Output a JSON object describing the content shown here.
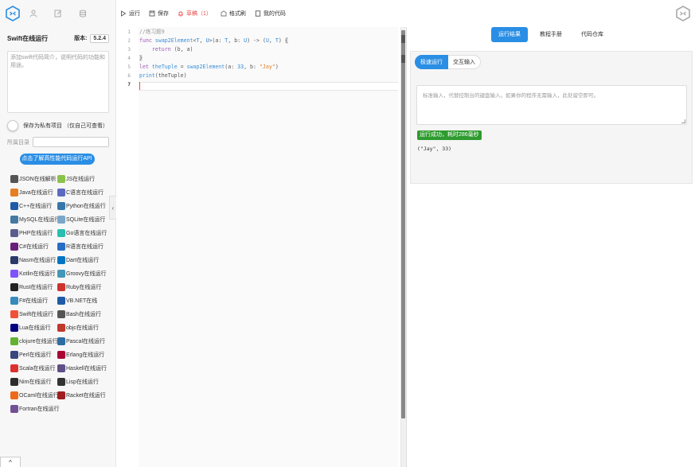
{
  "toolbar": {
    "run": "运行",
    "save": "保存",
    "draft": "草稿（1）",
    "format": "格式刷",
    "mycode": "我的代码"
  },
  "sidebar": {
    "title": "Swift在线运行",
    "version_label": "版本:",
    "version_value": "5.2.4",
    "desc_placeholder": "添加swift代码简介，说明代码的功能和用途。",
    "private_label": "保存为私有项目 （仅自己可查看）",
    "dir_label": "所属目录",
    "api_button": "点击了解高性能代码运行API",
    "languages": [
      {
        "label": "JSON在线解析",
        "color": "#555555",
        "icon": "json-icon"
      },
      {
        "label": "JS在线运行",
        "color": "#8bc34a",
        "icon": "nodejs-icon"
      },
      {
        "label": "Java在线运行",
        "color": "#e67e22",
        "icon": "java-icon"
      },
      {
        "label": "C语言在线运行",
        "color": "#5c6bc0",
        "icon": "c-icon"
      },
      {
        "label": "C++在线运行",
        "color": "#1e5aa8",
        "icon": "cpp-icon"
      },
      {
        "label": "Python在线运行",
        "color": "#3776ab",
        "icon": "python-icon"
      },
      {
        "label": "MySQL在线运行",
        "color": "#4479a1",
        "icon": "mysql-icon"
      },
      {
        "label": "SQLite在线运行",
        "color": "#7aa7c7",
        "icon": "sqlite-icon"
      },
      {
        "label": "PHP在线运行",
        "color": "#5b5e8c",
        "icon": "php-icon"
      },
      {
        "label": "Go语言在线运行",
        "color": "#29beb0",
        "icon": "go-icon"
      },
      {
        "label": "C#在线运行",
        "color": "#68217a",
        "icon": "csharp-icon"
      },
      {
        "label": "R语言在线运行",
        "color": "#276dc3",
        "icon": "r-icon"
      },
      {
        "label": "Nasm在线运行",
        "color": "#2b3a67",
        "icon": "nasm-icon"
      },
      {
        "label": "Dart在线运行",
        "color": "#0175c2",
        "icon": "dart-icon"
      },
      {
        "label": "Kotlin在线运行",
        "color": "#7f52ff",
        "icon": "kotlin-icon"
      },
      {
        "label": "Groovy在线运行",
        "color": "#4298b8",
        "icon": "groovy-icon"
      },
      {
        "label": "Rust在线运行",
        "color": "#222222",
        "icon": "rust-icon"
      },
      {
        "label": "Ruby在线运行",
        "color": "#cc342d",
        "icon": "ruby-icon"
      },
      {
        "label": "F#在线运行",
        "color": "#378bba",
        "icon": "fsharp-icon"
      },
      {
        "label": "VB.NET在线",
        "color": "#1e5aa8",
        "icon": "vbnet-icon"
      },
      {
        "label": "Swift在线运行",
        "color": "#f05138",
        "icon": "swift-icon"
      },
      {
        "label": "Bash在线运行",
        "color": "#555555",
        "icon": "bash-icon"
      },
      {
        "label": "Lua在线运行",
        "color": "#000080",
        "icon": "lua-icon"
      },
      {
        "label": "objc在线运行",
        "color": "#c0392b",
        "icon": "objc-icon"
      },
      {
        "label": "clojure在线运行",
        "color": "#63b132",
        "icon": "clojure-icon"
      },
      {
        "label": "Pascal在线运行",
        "color": "#2e6da4",
        "icon": "pascal-icon"
      },
      {
        "label": "Perl在线运行",
        "color": "#39457e",
        "icon": "perl-icon"
      },
      {
        "label": "Erlang在线运行",
        "color": "#a90533",
        "icon": "erlang-icon"
      },
      {
        "label": "Scala在线运行",
        "color": "#dc322f",
        "icon": "scala-icon"
      },
      {
        "label": "Haskell在线运行",
        "color": "#5e5086",
        "icon": "haskell-icon"
      },
      {
        "label": "Nim在线运行",
        "color": "#2d2d2d",
        "icon": "nim-icon"
      },
      {
        "label": "Lisp在线运行",
        "color": "#333333",
        "icon": "lisp-icon"
      },
      {
        "label": "OCaml在线运行",
        "color": "#ee6a1a",
        "icon": "ocaml-icon"
      },
      {
        "label": "Racket在线运行",
        "color": "#9f1d20",
        "icon": "racket-icon"
      },
      {
        "label": "Fortran在线运行",
        "color": "#734f96",
        "icon": "fortran-icon"
      }
    ]
  },
  "editor": {
    "line_numbers": [
      "1",
      "2",
      "3",
      "4",
      "5",
      "6",
      "7"
    ]
  },
  "right": {
    "tabs": [
      "运行结果",
      "教程手册",
      "代码仓库"
    ],
    "subtabs": [
      "极速运行",
      "交互输入"
    ],
    "stdin_placeholder": "标准输入，代替控制台的键盘输入。如果你的程序无需输入，此处留空即可。",
    "status": "运行成功，耗时286毫秒",
    "output": "(\"Jay\", 33)"
  },
  "colors": {
    "accent": "#2a8ee5",
    "success": "#2e9b2e",
    "draft": "#e94b4b"
  }
}
